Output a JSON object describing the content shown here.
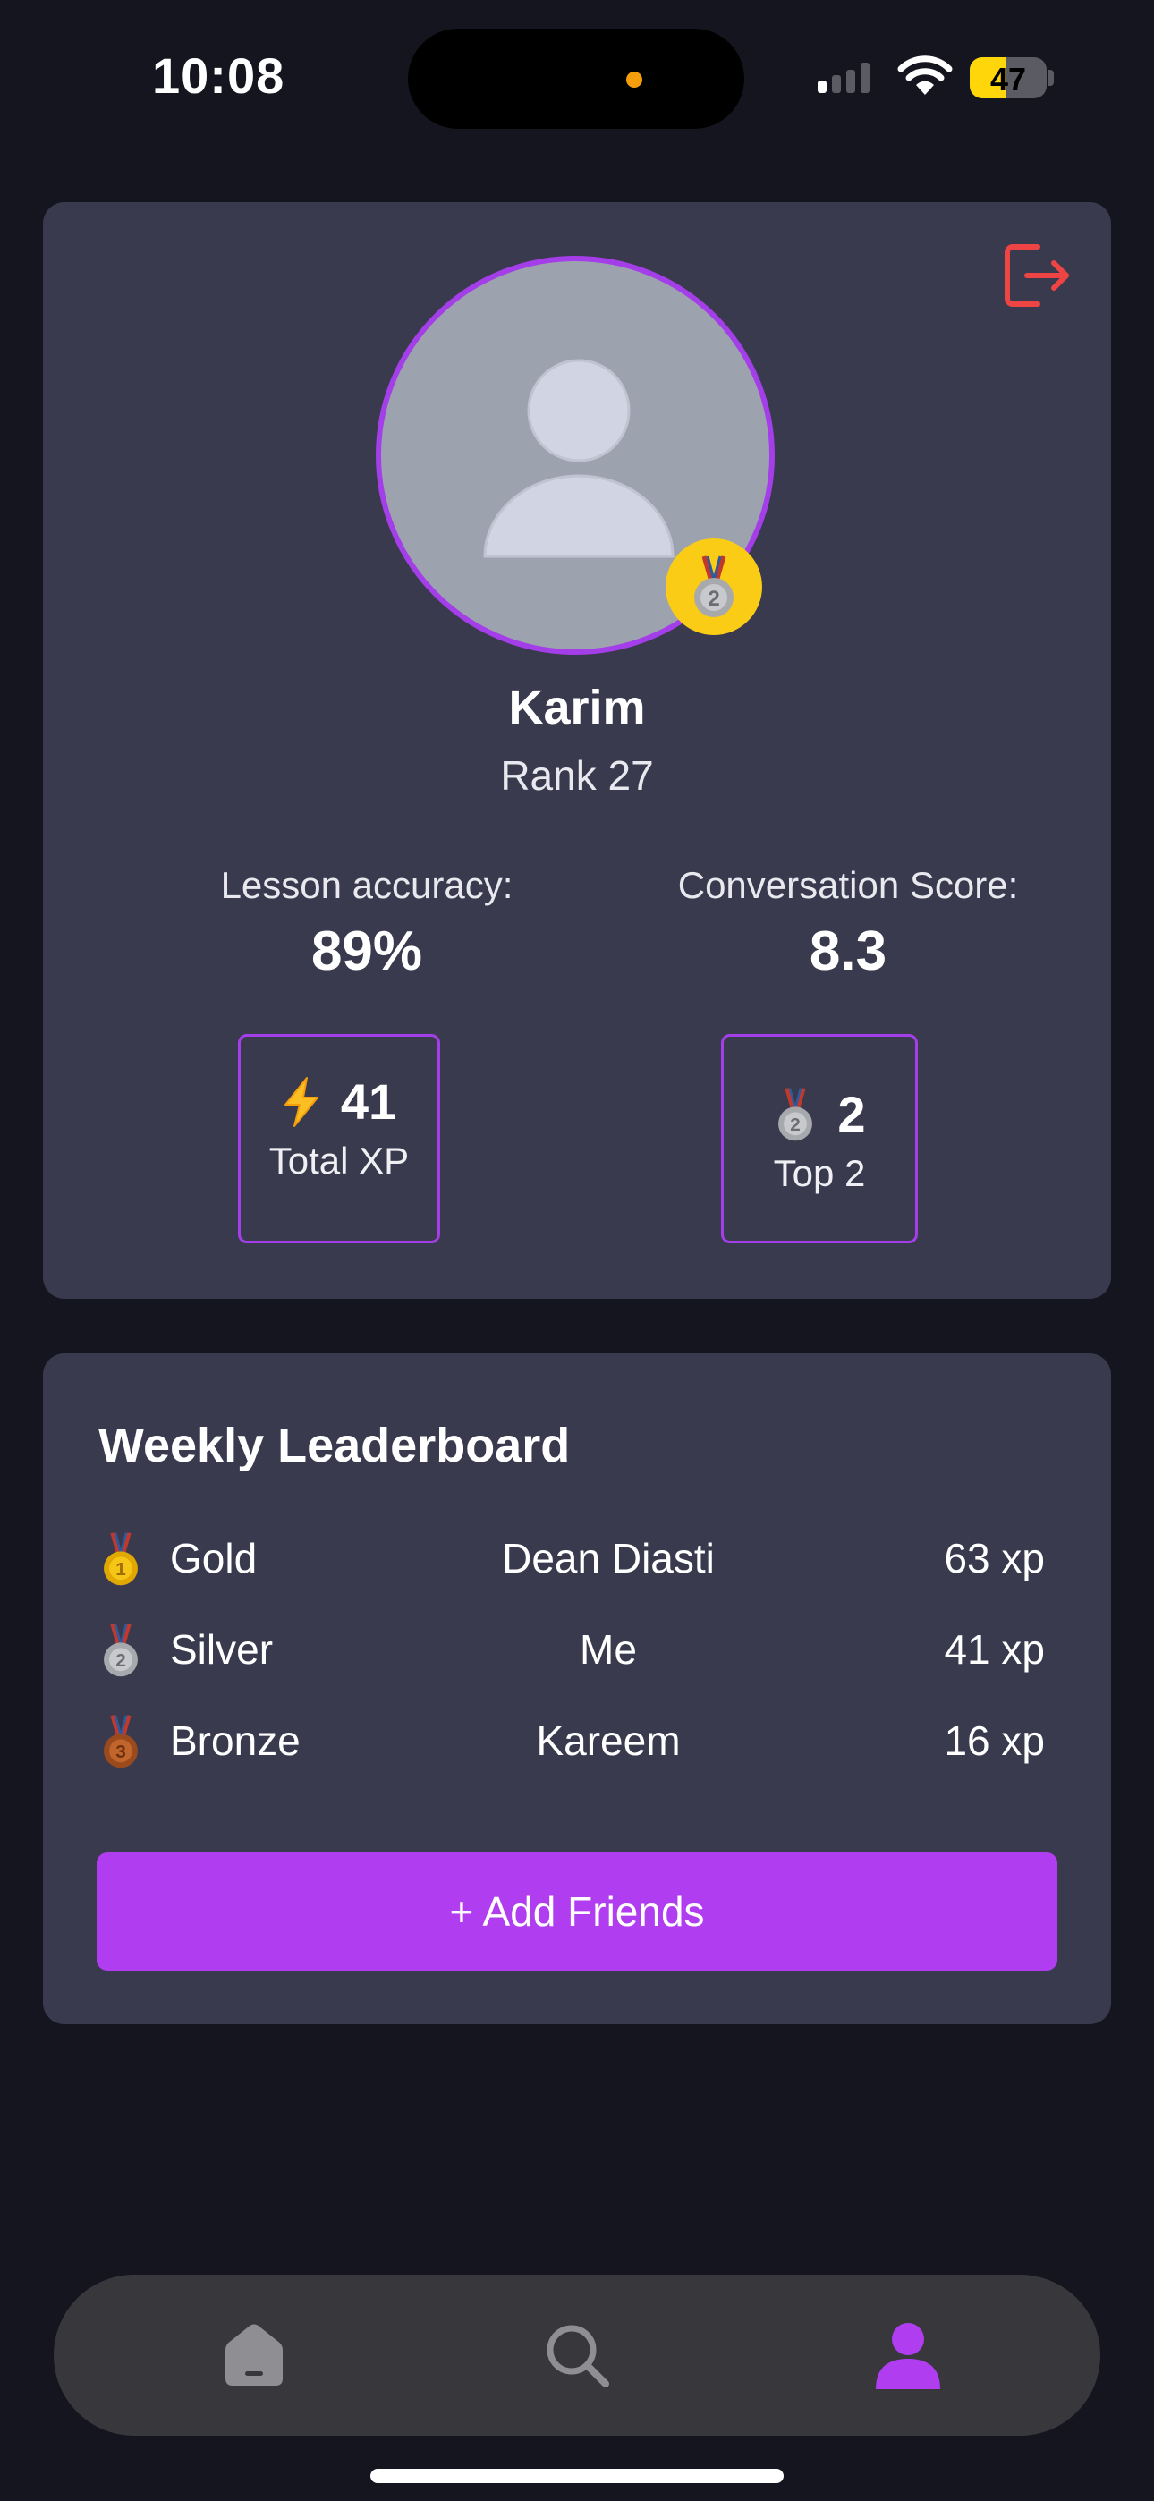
{
  "status_bar": {
    "time": "10:08",
    "battery": "47",
    "battery_level_percent": 47
  },
  "profile": {
    "name": "Karim",
    "rank": "Rank 27",
    "avatar_icon": "person-placeholder-icon",
    "badge_icon": "silver-medal-icon",
    "stats": [
      {
        "label": "Lesson accuracy:",
        "value": "89%"
      },
      {
        "label": "Conversation Score:",
        "value": "8.3"
      }
    ],
    "boxes": [
      {
        "icon": "lightning-icon",
        "number": "41",
        "label": "Total XP"
      },
      {
        "icon": "silver-medal-icon",
        "number": "2",
        "label": "Top 2"
      }
    ]
  },
  "leaderboard": {
    "title": "Weekly Leaderboard",
    "rows": [
      {
        "medal_icon": "gold-medal-icon",
        "tier": "Gold",
        "name": "Dean Diasti",
        "xp": "63 xp"
      },
      {
        "medal_icon": "silver-medal-icon",
        "tier": "Silver",
        "name": "Me",
        "xp": "41 xp"
      },
      {
        "medal_icon": "bronze-medal-icon",
        "tier": "Bronze",
        "name": "Kareem",
        "xp": "16 xp"
      }
    ],
    "add_button": "+ Add Friends"
  },
  "tabbar": {
    "tabs": [
      {
        "icon": "home-icon",
        "active": false
      },
      {
        "icon": "search-icon",
        "active": false
      },
      {
        "icon": "profile-icon",
        "active": true
      }
    ]
  },
  "colors": {
    "accent": "#a43ee8",
    "button": "#b03ef0",
    "card": "#3a3a4f",
    "background": "#15151f",
    "logout": "#ef4444"
  }
}
